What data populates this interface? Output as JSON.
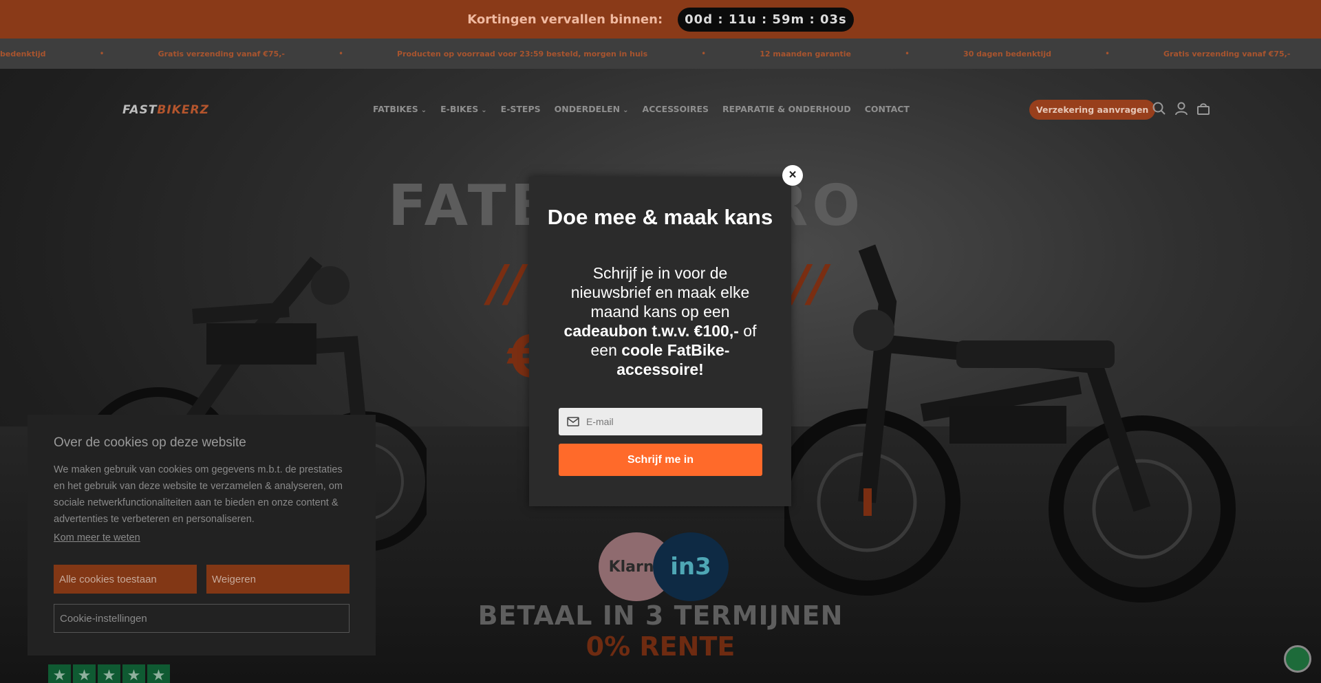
{
  "announcement": {
    "label": "Kortingen vervallen binnen:",
    "countdown": "00d : 11u : 59m : 03s"
  },
  "usp_marquee": {
    "items": [
      "bedenktijd",
      "Gratis verzending vanaf €75,-",
      "Producten op voorraad voor 23:59 besteld, morgen in huis",
      "12 maanden garantie",
      "30 dagen bedenktijd",
      "Gratis verzending vanaf €75,-"
    ]
  },
  "header": {
    "logo_fast": "FAST",
    "logo_bikerz": "BIKERZ",
    "menu": [
      {
        "label": "FATBIKES",
        "dropdown": true
      },
      {
        "label": "E-BIKES",
        "dropdown": true
      },
      {
        "label": "E-STEPS",
        "dropdown": false
      },
      {
        "label": "ONDERDELEN",
        "dropdown": true
      },
      {
        "label": "ACCESSOIRES",
        "dropdown": false
      },
      {
        "label": "REPARATIE & ONDERHOUD",
        "dropdown": false
      },
      {
        "label": "CONTACT",
        "dropdown": false
      }
    ],
    "insurance_button": "Verzekering aanvragen",
    "icons": [
      "search-icon",
      "account-icon",
      "cart-icon"
    ]
  },
  "hero": {
    "title_left": "FATB",
    "title_right": "PRO",
    "slashes_left": "//",
    "slashes_right": "//",
    "euro_fragment": "€",
    "klarna": "Klarna",
    "in3": "in3",
    "betaal": "BETAAL IN 3 TERMIJNEN",
    "rente": "0% RENTE"
  },
  "newsletter_modal": {
    "title": "Doe mee & maak kans",
    "body_1": "Schrijf je in voor de nieuwsbrief en maak elke maand kans op een ",
    "body_bold_1": "cadeaubon t.w.v. €100,-",
    "body_2": " of een ",
    "body_bold_2": "coole FatBike-accessoire!",
    "email_placeholder": "E-mail",
    "submit_label": "Schrijf me in",
    "close_label": "×"
  },
  "cookie_banner": {
    "title": "Over de cookies op deze website",
    "text": "We maken gebruik van cookies om gegevens m.b.t. de prestaties en het gebruik van deze website te verzamelen & analyseren, om sociale netwerkfunctionaliteiten aan te bieden en onze content & advertenties te verbeteren en personaliseren.",
    "learn_more": "Kom meer te weten",
    "accept_all": "Alle cookies toestaan",
    "decline": "Weigeren",
    "settings": "Cookie-instellingen"
  },
  "colors": {
    "brand_orange": "#ff6a2a",
    "topbar": "#8a3a18",
    "overlay_dark": "#2b2b2b"
  }
}
